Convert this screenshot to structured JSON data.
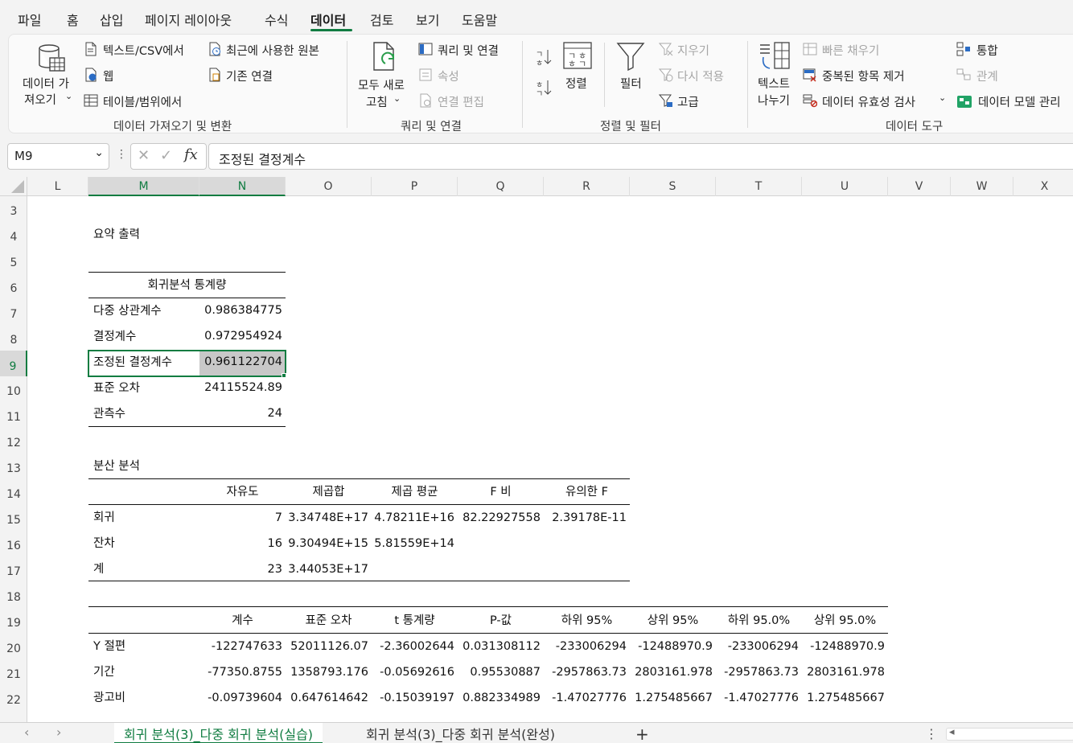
{
  "menu": {
    "tabs": [
      "파일",
      "홈",
      "삽입",
      "페이지 레이아웃",
      "수식",
      "데이터",
      "검토",
      "보기",
      "도움말"
    ],
    "active": "데이터"
  },
  "ribbon": {
    "get_data": {
      "big_label_1": "데이터 가",
      "big_label_2": "져오기",
      "text_csv": "텍스트/CSV에서",
      "web": "웹",
      "table_range": "테이블/범위에서",
      "recent_sources": "최근에 사용한 원본",
      "existing_conn": "기존 연결",
      "group": "데이터 가져오기 및 변환"
    },
    "queries": {
      "refresh_1": "모두 새로",
      "refresh_2": "고침",
      "queries_conn": "쿼리 및 연결",
      "properties": "속성",
      "edit_links": "연결 편집",
      "group": "쿼리 및 연결"
    },
    "sort_filter": {
      "sort": "정렬",
      "filter": "필터",
      "clear": "지우기",
      "reapply": "다시 적용",
      "advanced": "고급",
      "group": "정렬 및 필터"
    },
    "data_tools": {
      "text_to_cols_1": "텍스트",
      "text_to_cols_2": "나누기",
      "flash_fill": "빠른 채우기",
      "remove_dup": "중복된 항목 제거",
      "validation": "데이터 유효성 검사",
      "consolidate": "통합",
      "relations": "관계",
      "data_model": "데이터 모델 관리",
      "group": "데이터 도구"
    }
  },
  "formula_bar": {
    "name_box": "M9",
    "fx": "fx",
    "content": "조정된 결정계수"
  },
  "columns": [
    "L",
    "M",
    "N",
    "O",
    "P",
    "Q",
    "R",
    "S",
    "T",
    "U",
    "V",
    "W",
    "X"
  ],
  "rows": [
    "3",
    "4",
    "5",
    "6",
    "7",
    "8",
    "9",
    "10",
    "11",
    "12",
    "13",
    "14",
    "15",
    "16",
    "17",
    "18",
    "19",
    "20",
    "21",
    "22"
  ],
  "sheet": {
    "summary_title": "요약 출력",
    "reg_stats_header": "회귀분석 통계량",
    "reg_stats": [
      {
        "label": "다중 상관계수",
        "value": "0.986384775"
      },
      {
        "label": "결정계수",
        "value": "0.972954924"
      },
      {
        "label": "조정된 결정계수",
        "value": "0.961122704"
      },
      {
        "label": "표준 오차",
        "value": "24115524.89"
      },
      {
        "label": "관측수",
        "value": "24"
      }
    ],
    "anova_title": "분산 분석",
    "anova_headers": [
      "자유도",
      "제곱합",
      "제곱 평균",
      "F 비",
      "유의한 F"
    ],
    "anova_rows": [
      {
        "label": "회귀",
        "df": "7",
        "ss": "3.34748E+17",
        "ms": "4.78211E+16",
        "f": "82.22927558",
        "sigf": "2.39178E-11"
      },
      {
        "label": "잔차",
        "df": "16",
        "ss": "9.30494E+15",
        "ms": "5.81559E+14",
        "f": "",
        "sigf": ""
      },
      {
        "label": "계",
        "df": "23",
        "ss": "3.44053E+17",
        "ms": "",
        "f": "",
        "sigf": ""
      }
    ],
    "coef_headers": [
      "계수",
      "표준 오차",
      "t 통계량",
      "P-값",
      "하위 95%",
      "상위 95%",
      "하위 95.0%",
      "상위 95.0%"
    ],
    "coef_rows": [
      {
        "label": "Y 절편",
        "vals": [
          "-122747633",
          "52011126.07",
          "-2.36002644",
          "0.031308112",
          "-233006294",
          "-12488970.9",
          "-233006294",
          "-12488970.9"
        ]
      },
      {
        "label": "기간",
        "vals": [
          "-77350.8755",
          "1358793.176",
          "-0.05692616",
          "0.95530887",
          "-2957863.73",
          "2803161.978",
          "-2957863.73",
          "2803161.978"
        ]
      },
      {
        "label": "광고비",
        "vals": [
          "-0.09739604",
          "0.647614642",
          "-0.15039197",
          "0.882334989",
          "-1.47027776",
          "1.275485667",
          "-1.47027776",
          "1.275485667"
        ]
      }
    ]
  },
  "tabs": {
    "sheet1": "회귀 분석(3)_다중 회귀 분석(실습)",
    "sheet2": "회귀 분석(3)_다중 회귀 분석(완성)",
    "add": "+"
  },
  "colors": {
    "accent": "#107c41",
    "selection_fill": "#c8c8c8"
  }
}
